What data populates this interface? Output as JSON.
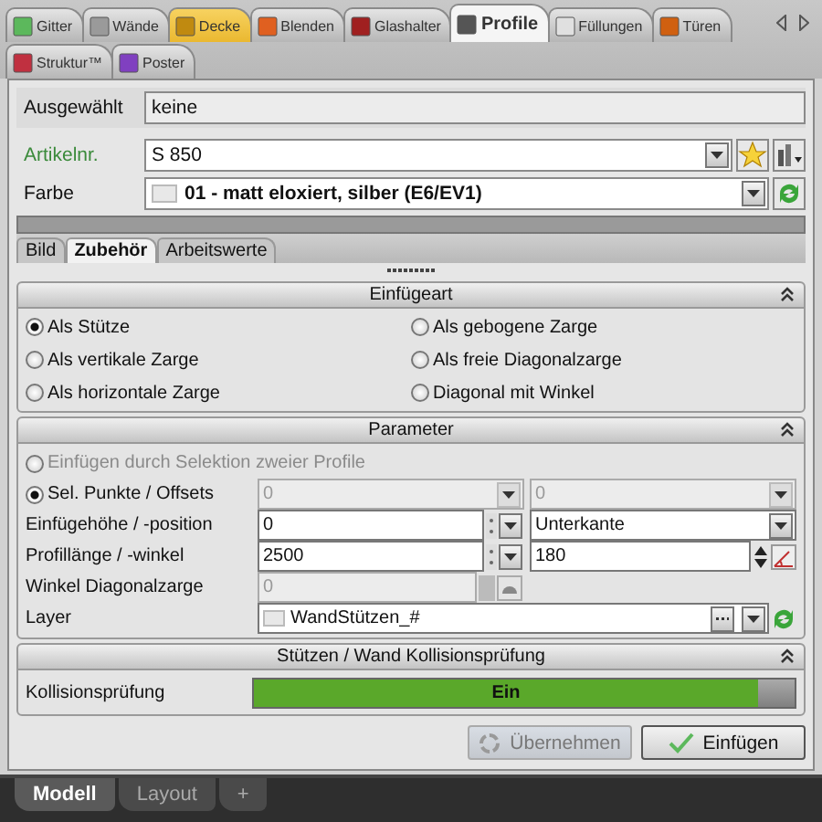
{
  "tab_rows": [
    [
      {
        "label": "Gitter",
        "selected": false,
        "highlighted": false,
        "color": "#5cb85c"
      },
      {
        "label": "Wände",
        "selected": false,
        "highlighted": false,
        "color": "#9a9a9a"
      },
      {
        "label": "Decke",
        "selected": false,
        "highlighted": true,
        "color": "#c08a10"
      },
      {
        "label": "Blenden",
        "selected": false,
        "highlighted": false,
        "color": "#e06020"
      },
      {
        "label": "Glashalter",
        "selected": false,
        "highlighted": false,
        "color": "#a02020"
      },
      {
        "label": "Profile",
        "selected": true,
        "highlighted": false,
        "color": "#555555"
      },
      {
        "label": "Füllungen",
        "selected": false,
        "highlighted": false,
        "color": "#e0e0e0"
      },
      {
        "label": "Türen",
        "selected": false,
        "highlighted": false,
        "color": "#d06010"
      }
    ],
    [
      {
        "label": "Struktur™",
        "selected": false,
        "highlighted": false,
        "color": "#c03040"
      },
      {
        "label": "Poster",
        "selected": false,
        "highlighted": false,
        "color": "#8040c0"
      }
    ]
  ],
  "fields": [
    {
      "kind": "readonly",
      "label": "Ausgewählt",
      "value": "keine"
    },
    {
      "kind": "article",
      "label": "Artikelnr.",
      "value": "S 850"
    },
    {
      "kind": "color",
      "label": "Farbe",
      "value": "01 - matt eloxiert, silber (E6/EV1)"
    }
  ],
  "subtabs": [
    {
      "label": "Bild",
      "selected": false
    },
    {
      "label": "Zubehör",
      "selected": true
    },
    {
      "label": "Arbeitswerte",
      "selected": false
    }
  ],
  "insert_type": {
    "title": "Einfügeart",
    "options": [
      {
        "label": "Als Stütze",
        "selected": true
      },
      {
        "label": "Als gebogene Zarge",
        "selected": false
      },
      {
        "label": "Als vertikale Zarge",
        "selected": false
      },
      {
        "label": "Als freie Diagonalzarge",
        "selected": false
      },
      {
        "label": "Als horizontale Zarge",
        "selected": false
      },
      {
        "label": "Diagonal mit Winkel",
        "selected": false
      }
    ]
  },
  "parameter": {
    "title": "Parameter",
    "rows": [
      {
        "kind": "radio",
        "label": "Einfügen durch Selektion zweier Profile",
        "selected": false,
        "disabled": true
      },
      {
        "kind": "radio",
        "label": "Sel. Punkte / Offsets",
        "selected": true,
        "disabled": false,
        "fields": [
          {
            "value": "0",
            "kind": "dropdown",
            "disabled": true
          },
          {
            "value": "0",
            "kind": "dropdown",
            "disabled": true
          }
        ]
      },
      {
        "kind": "row",
        "label": "Einfügehöhe / -position",
        "fields": [
          {
            "value": "0",
            "kind": "spin",
            "disabled": false
          },
          {
            "value": "Unterkante",
            "kind": "dropdown",
            "disabled": false
          }
        ]
      },
      {
        "kind": "row",
        "label": "Profillänge / -winkel",
        "fields": [
          {
            "value": "2500",
            "kind": "spin",
            "disabled": false
          },
          {
            "value": "180",
            "kind": "angle",
            "disabled": false
          }
        ]
      },
      {
        "kind": "row",
        "label": "Winkel Diagonalzarge",
        "fields": [
          {
            "value": "0",
            "kind": "anglesmall",
            "disabled": true
          }
        ]
      },
      {
        "kind": "row",
        "label": "Layer",
        "fields": [
          {
            "value": "WandStützen_#",
            "kind": "layer",
            "disabled": false
          }
        ]
      }
    ]
  },
  "collision": {
    "title": "Stützen / Wand Kollisionsprüfung",
    "label": "Kollisionsprüfung",
    "toggle": {
      "text": "Ein",
      "on": true
    }
  },
  "buttons": [
    {
      "label": "Übernehmen",
      "kind": "refresh",
      "disabled": true
    },
    {
      "label": "Einfügen",
      "kind": "check",
      "disabled": false
    }
  ],
  "bottom_tabs": [
    {
      "label": "Modell",
      "selected": true
    },
    {
      "label": "Layout",
      "selected": false
    },
    {
      "label": "+",
      "selected": false
    }
  ]
}
